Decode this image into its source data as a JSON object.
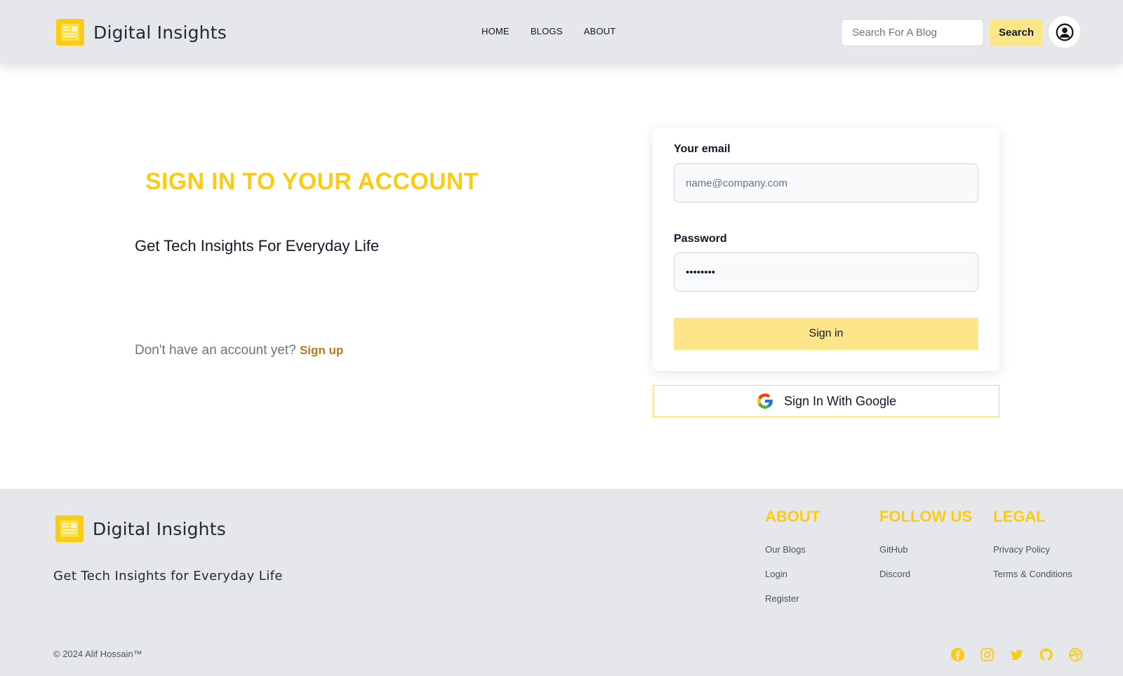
{
  "brand": {
    "name": "Digital Insights",
    "accent": "#facc15",
    "logo_icon": "newspaper-icon"
  },
  "nav": {
    "links": [
      "HOME",
      "BLOGS",
      "ABOUT"
    ]
  },
  "search": {
    "placeholder": "Search For A Blog",
    "button_label": "Search"
  },
  "account": {
    "icon": "user-circle-icon"
  },
  "hero": {
    "title": "SIGN IN TO YOUR ACCOUNT",
    "tagline": "Get Tech Insights For Everyday Life",
    "signup_prompt": "Don't have an account yet?",
    "signup_link": "Sign up"
  },
  "form": {
    "email_label": "Your email",
    "email_placeholder": "name@company.com",
    "password_label": "Password",
    "password_value": "••••••••",
    "submit_label": "Sign in",
    "google_label": "Sign In With Google"
  },
  "footer": {
    "brand_name": "Digital Insights",
    "tagline": "Get Tech Insights for Everyday Life",
    "columns": [
      {
        "heading": "ABOUT",
        "links": [
          "Our Blogs",
          "Login",
          "Register"
        ]
      },
      {
        "heading": "FOLLOW US",
        "links": [
          "GitHub",
          "Discord"
        ]
      },
      {
        "heading": "LEGAL",
        "links": [
          "Privacy Policy",
          "Terms & Conditions"
        ]
      }
    ],
    "copyright": "© 2024 Alif Hossain™",
    "social_icons": [
      "facebook-icon",
      "instagram-icon",
      "twitter-icon",
      "github-icon",
      "dribbble-icon"
    ]
  },
  "colors": {
    "navbar_bg": "#e5e7eb",
    "accent_yellow": "#facc15",
    "button_yellow": "#fde68a",
    "signup_link": "#b7791f"
  }
}
